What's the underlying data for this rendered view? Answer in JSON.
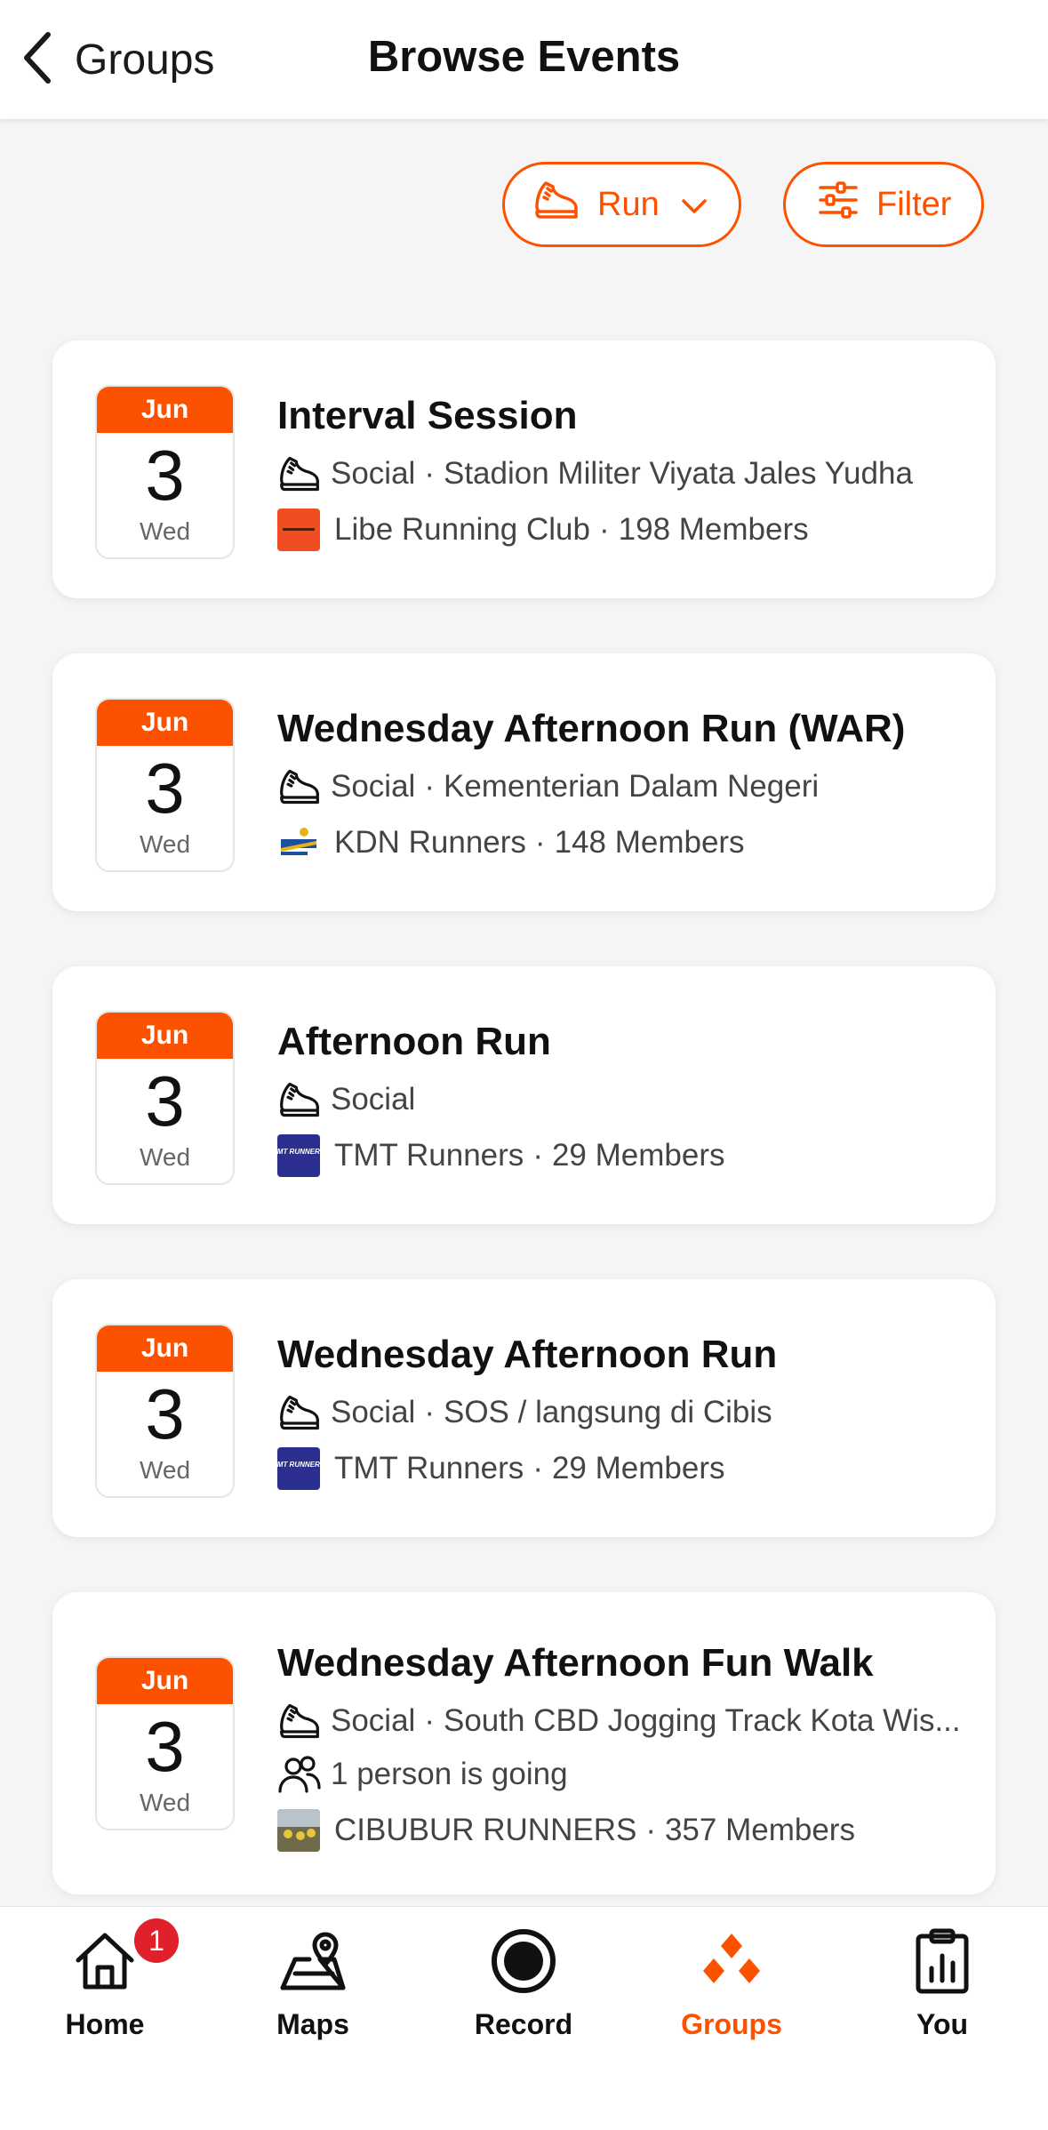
{
  "header": {
    "back_label": "Groups",
    "title": "Browse Events"
  },
  "filters": {
    "sport_label": "Run",
    "filter_label": "Filter"
  },
  "colors": {
    "accent": "#fc5200",
    "badge": "#e0202a",
    "background": "#f5f5f5"
  },
  "events": [
    {
      "month": "Jun",
      "day": "3",
      "weekday": "Wed",
      "title": "Interval Session",
      "type": "Social",
      "dot": "·",
      "location": "Stadion Militer Viyata Jales Yudha",
      "club": "Libe Running Club",
      "members": "198 Members"
    },
    {
      "month": "Jun",
      "day": "3",
      "weekday": "Wed",
      "title": "Wednesday Afternoon Run (WAR)",
      "type": "Social",
      "dot": "·",
      "location": "Kementerian Dalam Negeri",
      "club": "KDN Runners",
      "members": "148 Members"
    },
    {
      "month": "Jun",
      "day": "3",
      "weekday": "Wed",
      "title": "Afternoon Run",
      "type": "Social",
      "club": "TMT Runners",
      "members": "29 Members",
      "club_logo_text": "TMT RUNNERS"
    },
    {
      "month": "Jun",
      "day": "3",
      "weekday": "Wed",
      "title": "Wednesday Afternoon Run",
      "type": "Social",
      "dot": "·",
      "location": "SOS / langsung di Cibis",
      "club": "TMT Runners",
      "members": "29 Members",
      "club_logo_text": "TMT RUNNERS"
    },
    {
      "month": "Jun",
      "day": "3",
      "weekday": "Wed",
      "title": "Wednesday Afternoon Fun Walk",
      "type": "Social",
      "dot": "·",
      "location": "South CBD Jogging Track Kota Wis...",
      "attendance": "1 person is going",
      "club": "CIBUBUR RUNNERS",
      "members": "357 Members"
    }
  ],
  "separator": "·",
  "tabbar": {
    "home": "Home",
    "home_badge": "1",
    "maps": "Maps",
    "record": "Record",
    "groups": "Groups",
    "you": "You"
  }
}
